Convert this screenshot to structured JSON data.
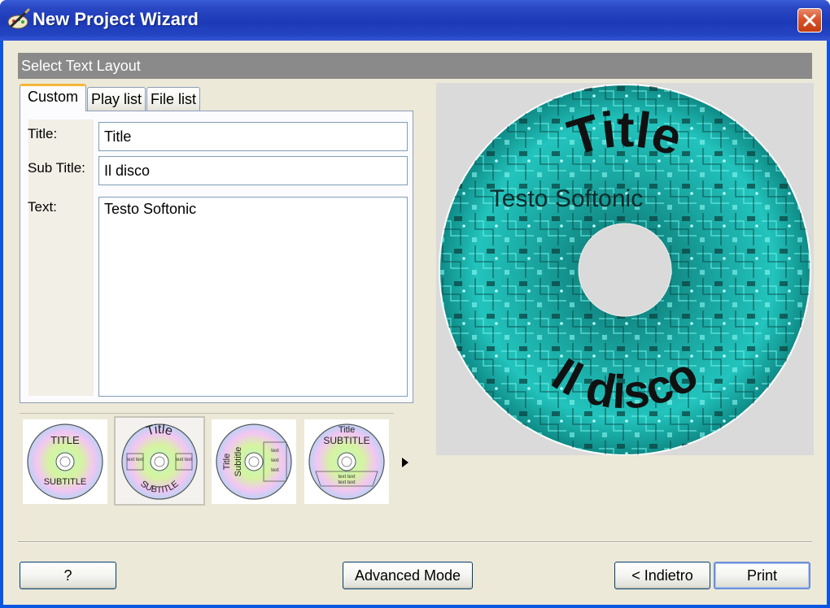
{
  "window": {
    "title": "New Project Wizard",
    "accent_color": "#2344c2",
    "close_icon": "close-icon"
  },
  "section": {
    "header": "Select Text Layout"
  },
  "tabs": [
    {
      "label": "Custom",
      "active": true
    },
    {
      "label": "Play list",
      "active": false
    },
    {
      "label": "File list",
      "active": false
    }
  ],
  "form": {
    "title_label": "Title:",
    "title_value": "Title",
    "subtitle_label": "Sub Title:",
    "subtitle_value": "Il disco",
    "text_label": "Text:",
    "text_value": "Testo Softonic"
  },
  "layouts": [
    {
      "top": "TITLE",
      "bottom": "SUBTITLE",
      "selected": false
    },
    {
      "top": "Title",
      "bottom": "SUBTITLE",
      "side": "text text",
      "selected": true
    },
    {
      "top": "Title",
      "bottom": "Subtitle",
      "side": "text",
      "selected": false
    },
    {
      "top": "Title",
      "middle": "SUBTITLE",
      "bottom": "text text",
      "selected": false
    }
  ],
  "preview": {
    "title": "Title",
    "subtitle": "Il disco",
    "text": "Testo Softonic",
    "disc_color": "#1fb5b0"
  },
  "buttons": {
    "help": "?",
    "advanced": "Advanced Mode",
    "back": "< Indietro",
    "print": "Print"
  }
}
